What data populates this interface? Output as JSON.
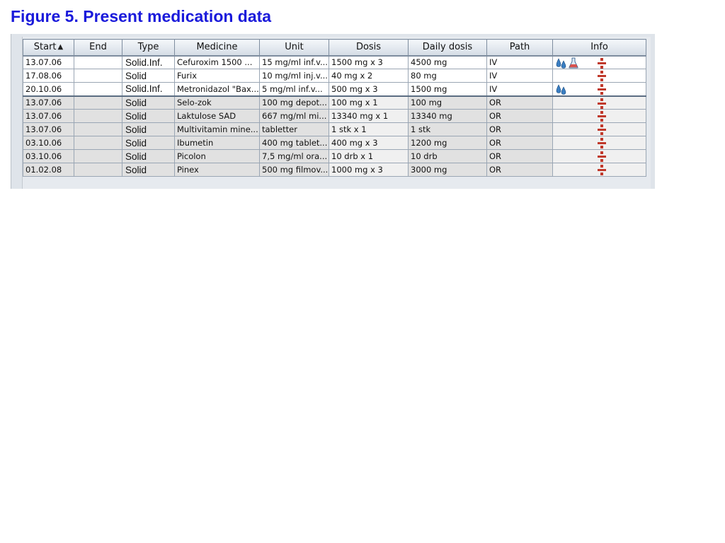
{
  "figure_title": "Figure 5. Present medication data",
  "columns": [
    {
      "key": "start",
      "label": "Start"
    },
    {
      "key": "end",
      "label": "End"
    },
    {
      "key": "type",
      "label": "Type"
    },
    {
      "key": "medicine",
      "label": "Medicine"
    },
    {
      "key": "unit",
      "label": "Unit"
    },
    {
      "key": "dosis",
      "label": "Dosis"
    },
    {
      "key": "daily",
      "label": "Daily dosis"
    },
    {
      "key": "path",
      "label": "Path"
    },
    {
      "key": "info",
      "label": "Info"
    }
  ],
  "sort": {
    "column": "start",
    "direction": "ascending",
    "icon": "triangle-up-icon"
  },
  "rows": [
    {
      "start": "13.07.06",
      "end": "",
      "type": "Solid.Inf.",
      "medicine": "Cefuroxim 1500 ...",
      "unit": "15 mg/ml inf.v...",
      "dosis": "1500 mg x 3",
      "daily": "4500 mg",
      "path": "IV",
      "icons": [
        "drops-icon",
        "flask-icon",
        "divide-icon"
      ]
    },
    {
      "start": "17.08.06",
      "end": "",
      "type": "Solid",
      "medicine": "Furix",
      "unit": "10 mg/ml inj.v...",
      "dosis": "40 mg x 2",
      "daily": "80 mg",
      "path": "IV",
      "icons": [
        "divide-icon"
      ]
    },
    {
      "start": "20.10.06",
      "end": "",
      "type": "Solid.Inf.",
      "medicine": "Metronidazol \"Bax...",
      "unit": "5 mg/ml inf.v...",
      "dosis": "500 mg x 3",
      "daily": "1500 mg",
      "path": "IV",
      "icons": [
        "drops-icon",
        "divide-icon"
      ]
    },
    {
      "start": "13.07.06",
      "end": "",
      "type": "Solid",
      "medicine": "Selo-zok",
      "unit": "100 mg depot...",
      "dosis": "100 mg x 1",
      "daily": "100 mg",
      "path": "OR",
      "icons": [
        "divide-icon"
      ]
    },
    {
      "start": "13.07.06",
      "end": "",
      "type": "Solid",
      "medicine": "Laktulose SAD",
      "unit": "667 mg/ml mi...",
      "dosis": "13340 mg x 1",
      "daily": "13340 mg",
      "path": "OR",
      "icons": [
        "divide-icon"
      ]
    },
    {
      "start": "13.07.06",
      "end": "",
      "type": "Solid",
      "medicine": "Multivitamin mine...",
      "unit": " tabletter",
      "dosis": "1 stk x 1",
      "daily": "1 stk",
      "path": "OR",
      "icons": [
        "divide-icon"
      ]
    },
    {
      "start": "03.10.06",
      "end": "",
      "type": "Solid",
      "medicine": "Ibumetin",
      "unit": "400 mg tablet...",
      "dosis": "400 mg x 3",
      "daily": "1200 mg",
      "path": "OR",
      "icons": [
        "divide-icon"
      ]
    },
    {
      "start": "03.10.06",
      "end": "",
      "type": "Solid",
      "medicine": "Picolon",
      "unit": "7,5 mg/ml ora...",
      "dosis": "10 drb x 1",
      "daily": "10 drb",
      "path": "OR",
      "icons": [
        "divide-icon"
      ]
    },
    {
      "start": "01.02.08",
      "end": "",
      "type": "Solid",
      "medicine": "Pinex",
      "unit": "500 mg filmov...",
      "dosis": "1000 mg x 3",
      "daily": "3000 mg",
      "path": "OR",
      "icons": [
        "divide-icon"
      ]
    }
  ],
  "colors": {
    "title": "#1a1adb",
    "divide_icon": "#c0392b",
    "drops_icon": "#3a7ec2",
    "flask_icon": "#d9534f"
  }
}
